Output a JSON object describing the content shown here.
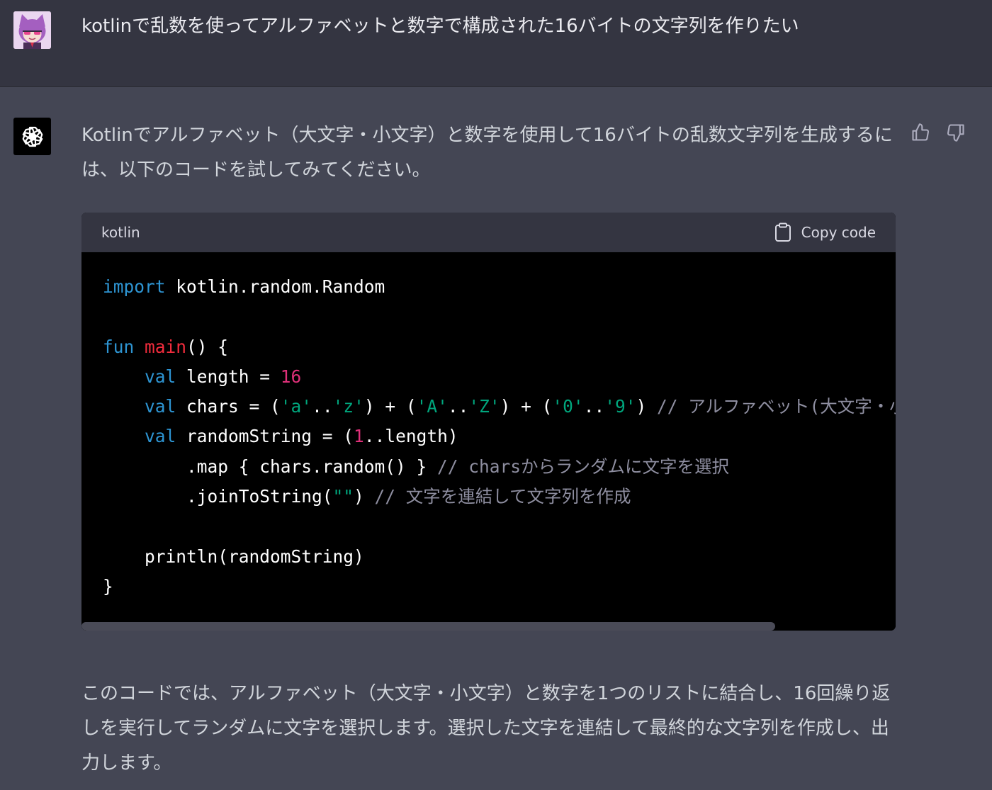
{
  "user": {
    "avatar_icon": "anime-girl-avatar",
    "message": "kotlinで乱数を使ってアルファベットと数字で構成された16バイトの文字列を作りたい"
  },
  "assistant": {
    "avatar_icon": "openai-logo-icon",
    "intro": "Kotlinでアルファベット（大文字・小文字）と数字を使用して16バイトの乱数文字列を生成するには、以下のコードを試してみてください。",
    "feedback": {
      "thumbs_up_icon": "thumbs-up-icon",
      "thumbs_down_icon": "thumbs-down-icon"
    },
    "code_block": {
      "language": "kotlin",
      "copy_label": "Copy code",
      "copy_icon": "clipboard-icon",
      "lines": [
        [
          {
            "t": "import",
            "c": "kw"
          },
          {
            "t": " kotlin.random.Random",
            "c": ""
          }
        ],
        [],
        [
          {
            "t": "fun",
            "c": "kw"
          },
          {
            "t": " ",
            "c": ""
          },
          {
            "t": "main",
            "c": "fn"
          },
          {
            "t": "() {",
            "c": ""
          }
        ],
        [
          {
            "t": "    ",
            "c": ""
          },
          {
            "t": "val",
            "c": "kw"
          },
          {
            "t": " length = ",
            "c": ""
          },
          {
            "t": "16",
            "c": "num"
          }
        ],
        [
          {
            "t": "    ",
            "c": ""
          },
          {
            "t": "val",
            "c": "kw"
          },
          {
            "t": " chars = (",
            "c": ""
          },
          {
            "t": "'a'",
            "c": "str"
          },
          {
            "t": "..",
            "c": ""
          },
          {
            "t": "'z'",
            "c": "str"
          },
          {
            "t": ") + (",
            "c": ""
          },
          {
            "t": "'A'",
            "c": "str"
          },
          {
            "t": "..",
            "c": ""
          },
          {
            "t": "'Z'",
            "c": "str"
          },
          {
            "t": ") + (",
            "c": ""
          },
          {
            "t": "'0'",
            "c": "str"
          },
          {
            "t": "..",
            "c": ""
          },
          {
            "t": "'9'",
            "c": "str"
          },
          {
            "t": ") ",
            "c": ""
          },
          {
            "t": "// アルファベット(大文字・小文字",
            "c": "cm"
          }
        ],
        [
          {
            "t": "    ",
            "c": ""
          },
          {
            "t": "val",
            "c": "kw"
          },
          {
            "t": " randomString = (",
            "c": ""
          },
          {
            "t": "1",
            "c": "num"
          },
          {
            "t": "..length)",
            "c": ""
          }
        ],
        [
          {
            "t": "        .map { chars.random() } ",
            "c": ""
          },
          {
            "t": "// charsからランダムに文字を選択",
            "c": "cm"
          }
        ],
        [
          {
            "t": "        .joinToString(",
            "c": ""
          },
          {
            "t": "\"\"",
            "c": "str"
          },
          {
            "t": ") ",
            "c": ""
          },
          {
            "t": "// 文字を連結して文字列を作成",
            "c": "cm"
          }
        ],
        [],
        [
          {
            "t": "    println(randomString)",
            "c": ""
          }
        ],
        [
          {
            "t": "}",
            "c": ""
          }
        ]
      ]
    },
    "outro": "このコードでは、アルファベット（大文字・小文字）と数字を1つのリストに結合し、16回繰り返しを実行してランダムに文字を選択します。選択した文字を連結して最終的な文字列を作成し、出力します。"
  }
}
